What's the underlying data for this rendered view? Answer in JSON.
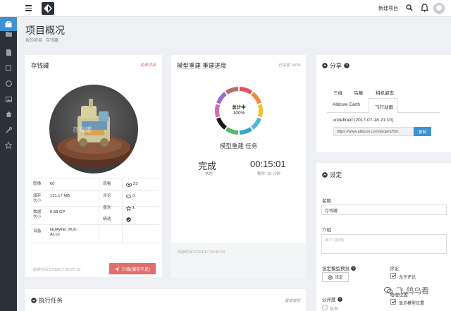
{
  "topbar": {
    "new_project": "新建项目"
  },
  "page": {
    "title": "项目概况",
    "breadcrumb": [
      "我的项目",
      "存钱罐"
    ]
  },
  "project_card": {
    "name": "存钱罐",
    "tag": "免费项目",
    "tag_color": "#e36c6c",
    "watermark": "存钱罐",
    "stats": {
      "left": [
        {
          "label": "图像",
          "value": "60"
        },
        {
          "label": "储存大小",
          "value": "131.17 MB"
        },
        {
          "label": "数据大小",
          "value": "0.58 GP"
        },
        {
          "label": "设备",
          "value": "HUAWEI_PLK-AL10"
        }
      ],
      "right": [
        {
          "label": "观看",
          "icon": "eye-icon",
          "value": "23"
        },
        {
          "label": "评论",
          "icon": "comment-icon",
          "value": "0"
        },
        {
          "label": "喜欢",
          "icon": "star-icon",
          "value": "1"
        },
        {
          "label": "精选",
          "icon": "check-circle-icon",
          "value": ""
        }
      ]
    },
    "created": "创建时间 07/18/17 20:27:19",
    "upgrade_button": "升级(储存不足)"
  },
  "task_card": {
    "title": "模型重建 重建进度",
    "tag": "已完成 100%",
    "donut_center_title": "总计中",
    "donut_center_pct": "100%",
    "donut_colors": [
      "#e2555a",
      "#f08a3e",
      "#f3c230",
      "#4fb6de",
      "#3aa5c9",
      "#57b86b",
      "#1a1a1a",
      "#d66ab0",
      "#9d6ad3",
      "#b86e6e"
    ],
    "task_label": "模型重建 任务",
    "status": "完成",
    "status_label": "状态",
    "duration": "00:15:01",
    "duration_label": "耗时: 15 分钟",
    "started": "开始时间 07/18/17 20:36:00"
  },
  "share_card": {
    "title": "分享",
    "tabs_row1": [
      "三维",
      "鸟瞰",
      "相机姿态"
    ],
    "tabs_row2": [
      "Altizure Earth",
      "飞行动画"
    ],
    "active_tab": "飞行动画",
    "date_line": "undefined (2017-07-18 21:10)",
    "url": "https://www.altizure.com/project/59c",
    "copy_button": "复制"
  },
  "settings_card": {
    "title": "设定",
    "name_label": "名称",
    "name_value": "存钱罐",
    "intro_label": "介绍",
    "intro_placeholder": "简介 (选填)",
    "preview_label": "设定模型预览",
    "preview_button": "设定",
    "comment_label": "评论",
    "allow_comment": "允许评论",
    "location_label": "地理位置",
    "show_location": "显示模型位置",
    "public_label": "公开度",
    "private_option": "私有"
  },
  "exec_card": {
    "title": "执行任务",
    "tag": "重建模型"
  },
  "brand_mark": "飞 鸽乌看"
}
